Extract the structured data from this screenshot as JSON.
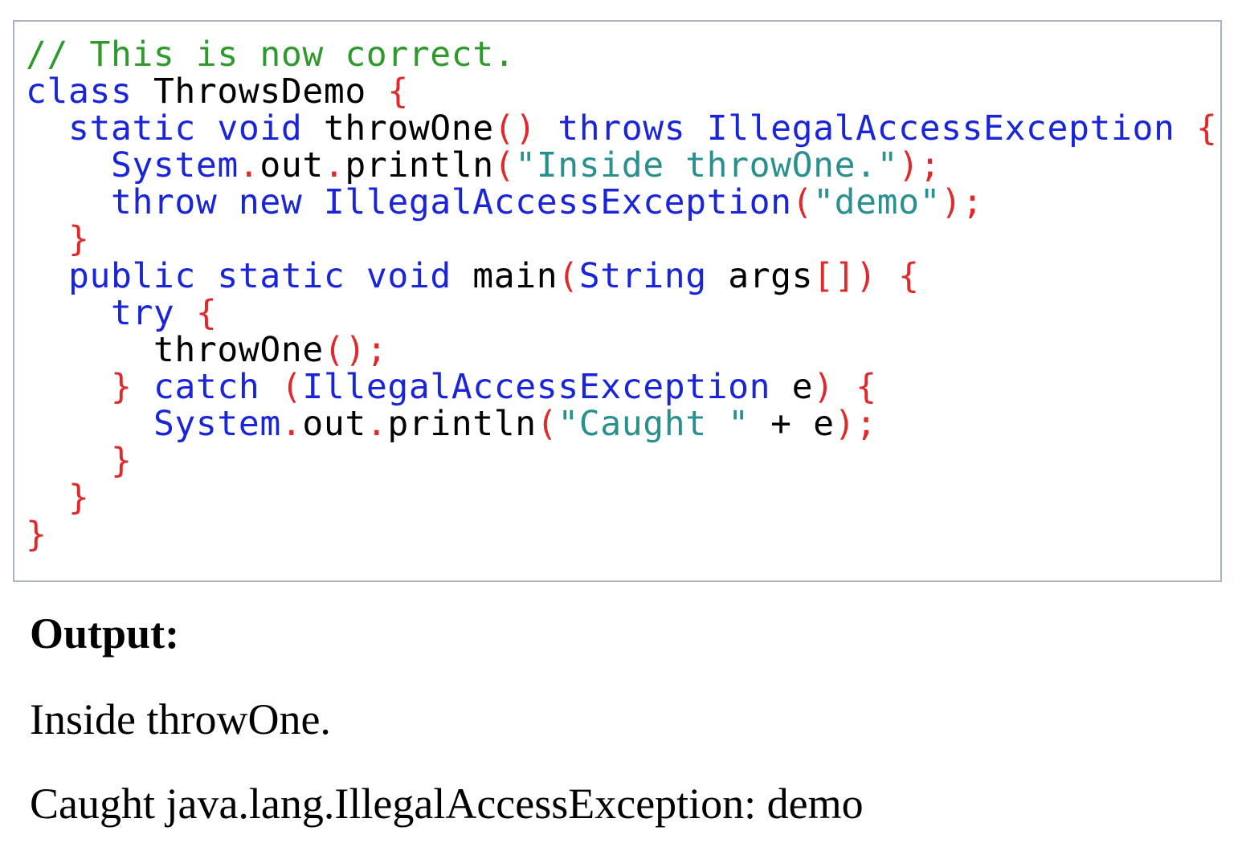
{
  "code": {
    "lines": [
      [
        {
          "t": "// This is now correct.",
          "k": "comment"
        }
      ],
      [
        {
          "t": "class",
          "k": "keyword"
        },
        {
          "t": " ThrowsDemo ",
          "k": "ident"
        },
        {
          "t": "{",
          "k": "punct"
        }
      ],
      [
        {
          "t": "  ",
          "k": "plain"
        },
        {
          "t": "static",
          "k": "keyword"
        },
        {
          "t": " ",
          "k": "plain"
        },
        {
          "t": "void",
          "k": "keyword"
        },
        {
          "t": " throwOne",
          "k": "ident"
        },
        {
          "t": "()",
          "k": "punct"
        },
        {
          "t": " ",
          "k": "plain"
        },
        {
          "t": "throws",
          "k": "keyword"
        },
        {
          "t": " ",
          "k": "plain"
        },
        {
          "t": "IllegalAccessException",
          "k": "type"
        },
        {
          "t": " ",
          "k": "plain"
        },
        {
          "t": "{",
          "k": "punct"
        }
      ],
      [
        {
          "t": "    ",
          "k": "plain"
        },
        {
          "t": "System",
          "k": "type"
        },
        {
          "t": ".",
          "k": "punct"
        },
        {
          "t": "out",
          "k": "ident"
        },
        {
          "t": ".",
          "k": "punct"
        },
        {
          "t": "println",
          "k": "ident"
        },
        {
          "t": "(",
          "k": "punct"
        },
        {
          "t": "\"Inside throwOne.\"",
          "k": "string"
        },
        {
          "t": ");",
          "k": "punct"
        }
      ],
      [
        {
          "t": "    ",
          "k": "plain"
        },
        {
          "t": "throw",
          "k": "keyword"
        },
        {
          "t": " ",
          "k": "plain"
        },
        {
          "t": "new",
          "k": "keyword"
        },
        {
          "t": " ",
          "k": "plain"
        },
        {
          "t": "IllegalAccessException",
          "k": "type"
        },
        {
          "t": "(",
          "k": "punct"
        },
        {
          "t": "\"demo\"",
          "k": "string"
        },
        {
          "t": ");",
          "k": "punct"
        }
      ],
      [
        {
          "t": "  ",
          "k": "plain"
        },
        {
          "t": "}",
          "k": "punct"
        }
      ],
      [
        {
          "t": "  ",
          "k": "plain"
        },
        {
          "t": "public",
          "k": "keyword"
        },
        {
          "t": " ",
          "k": "plain"
        },
        {
          "t": "static",
          "k": "keyword"
        },
        {
          "t": " ",
          "k": "plain"
        },
        {
          "t": "void",
          "k": "keyword"
        },
        {
          "t": " main",
          "k": "ident"
        },
        {
          "t": "(",
          "k": "punct"
        },
        {
          "t": "String",
          "k": "type"
        },
        {
          "t": " args",
          "k": "ident"
        },
        {
          "t": "[])",
          "k": "punct"
        },
        {
          "t": " ",
          "k": "plain"
        },
        {
          "t": "{",
          "k": "punct"
        }
      ],
      [
        {
          "t": "    ",
          "k": "plain"
        },
        {
          "t": "try",
          "k": "keyword"
        },
        {
          "t": " ",
          "k": "plain"
        },
        {
          "t": "{",
          "k": "punct"
        }
      ],
      [
        {
          "t": "      throwOne",
          "k": "ident"
        },
        {
          "t": "();",
          "k": "punct"
        }
      ],
      [
        {
          "t": "    ",
          "k": "plain"
        },
        {
          "t": "}",
          "k": "punct"
        },
        {
          "t": " ",
          "k": "plain"
        },
        {
          "t": "catch",
          "k": "keyword"
        },
        {
          "t": " ",
          "k": "plain"
        },
        {
          "t": "(",
          "k": "punct"
        },
        {
          "t": "IllegalAccessException",
          "k": "type"
        },
        {
          "t": " e",
          "k": "ident"
        },
        {
          "t": ")",
          "k": "punct"
        },
        {
          "t": " ",
          "k": "plain"
        },
        {
          "t": "{",
          "k": "punct"
        }
      ],
      [
        {
          "t": "      ",
          "k": "plain"
        },
        {
          "t": "System",
          "k": "type"
        },
        {
          "t": ".",
          "k": "punct"
        },
        {
          "t": "out",
          "k": "ident"
        },
        {
          "t": ".",
          "k": "punct"
        },
        {
          "t": "println",
          "k": "ident"
        },
        {
          "t": "(",
          "k": "punct"
        },
        {
          "t": "\"Caught \"",
          "k": "string"
        },
        {
          "t": " + e",
          "k": "ident"
        },
        {
          "t": ");",
          "k": "punct"
        }
      ],
      [
        {
          "t": "    ",
          "k": "plain"
        },
        {
          "t": "}",
          "k": "punct"
        }
      ],
      [
        {
          "t": "  ",
          "k": "plain"
        },
        {
          "t": "}",
          "k": "punct"
        }
      ],
      [
        {
          "t": "}",
          "k": "punct"
        }
      ]
    ]
  },
  "output": {
    "title": "Output:",
    "lines": [
      "Inside throwOne.",
      "Caught java.lang.IllegalAccessException: demo"
    ]
  }
}
